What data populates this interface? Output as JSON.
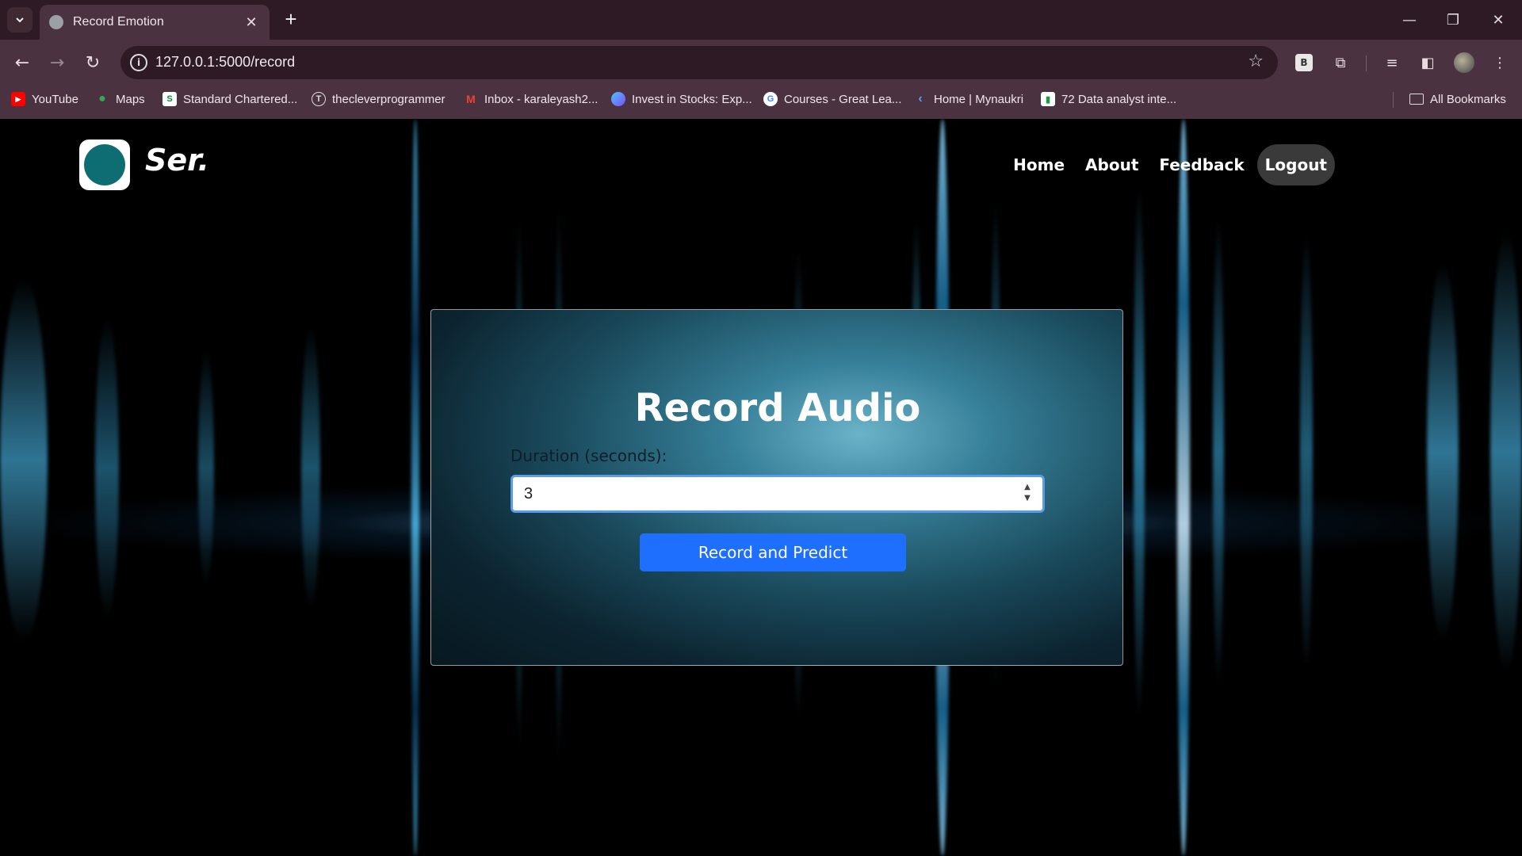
{
  "browser": {
    "tab_title": "Record Emotion",
    "url": "127.0.0.1:5000/record",
    "bookmarks": [
      "YouTube",
      "Maps",
      "Standard Chartered...",
      "thecleverprogrammer",
      "Inbox - karaleyash2...",
      "Invest in Stocks: Exp...",
      "Courses - Great Lea...",
      "Home | Mynaukri",
      "72 Data analyst inte..."
    ],
    "all_bookmarks": "All Bookmarks"
  },
  "site": {
    "brand": "Ser.",
    "nav": {
      "home": "Home",
      "about": "About",
      "feedback": "Feedback",
      "logout": "Logout"
    }
  },
  "record_card": {
    "title": "Record Audio",
    "duration_label": "Duration (seconds):",
    "duration_value": "3",
    "button_label": "Record and Predict"
  },
  "colors": {
    "browser_frame": "#2e1a24",
    "browser_toolbar": "#4a3240",
    "accent_button": "#1f6fff",
    "glow": "#4fc3f7"
  }
}
